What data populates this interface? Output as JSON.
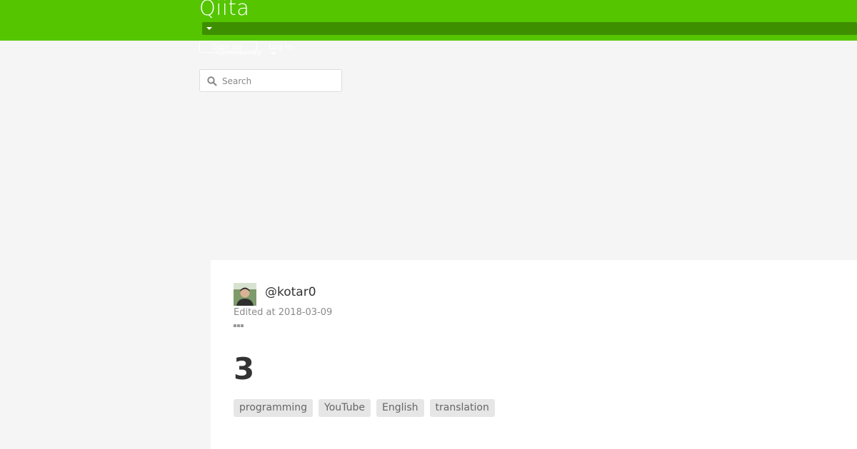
{
  "header": {
    "logo_text": "Qiita",
    "signup_label": "Sign up",
    "login_label": "Log in",
    "community_label": "Community",
    "brand_color": "#55c500"
  },
  "search": {
    "placeholder": "Search",
    "value": ""
  },
  "article": {
    "author": "@kotar0",
    "edited_label": "Edited at",
    "edited_date": "2018-03-09",
    "title": "3",
    "tags": [
      "programming",
      "YouTube",
      "English",
      "translation"
    ]
  }
}
